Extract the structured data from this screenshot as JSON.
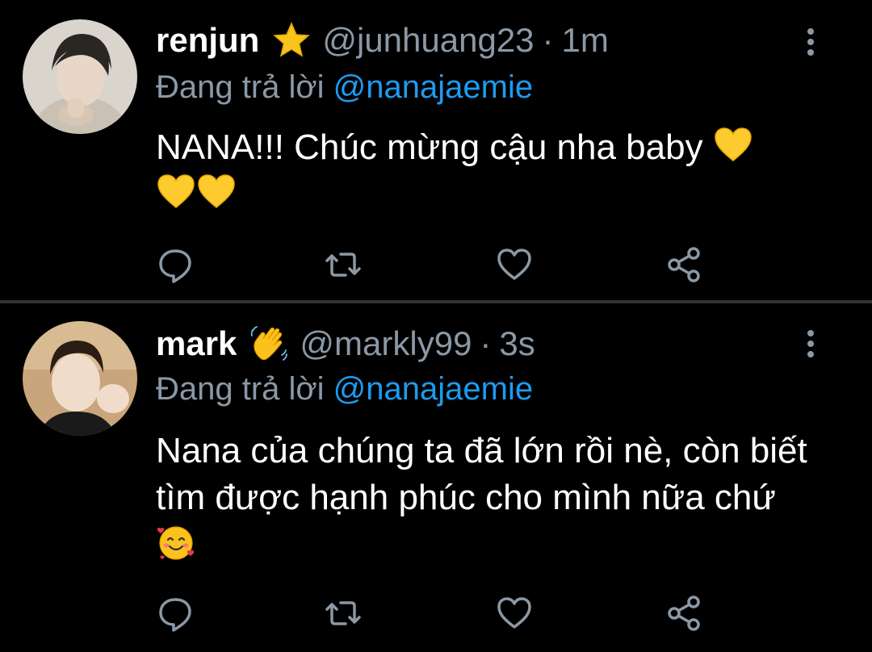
{
  "colors": {
    "background": "#000000",
    "text": "#ffffff",
    "muted": "#8b98a5",
    "mention": "#1d9bf0",
    "divider": "#2f3336"
  },
  "tweets": [
    {
      "name": "renjun",
      "name_emoji": "star",
      "handle": "@junhuang23",
      "separator": "·",
      "time": "1m",
      "replying_prefix": "Đang trả lời",
      "replying_to": "@nanajaemie",
      "text": "NANA!!! Chúc mừng cậu nha baby",
      "text_emojis": [
        "yellow-heart",
        "yellow-heart",
        "yellow-heart"
      ]
    },
    {
      "name": "mark",
      "name_emoji": "waving-hand",
      "handle": "@markly99",
      "separator": "·",
      "time": "3s",
      "replying_prefix": "Đang trả lời",
      "replying_to": "@nanajaemie",
      "text": "Nana của chúng ta đã lớn rồi nè, còn biết tìm được hạnh phúc cho mình nữa chứ",
      "text_emojis": [
        "smiling-face-with-hearts"
      ]
    }
  ],
  "actions": {
    "icons": [
      "reply-icon",
      "retweet-icon",
      "like-icon",
      "share-icon"
    ]
  }
}
